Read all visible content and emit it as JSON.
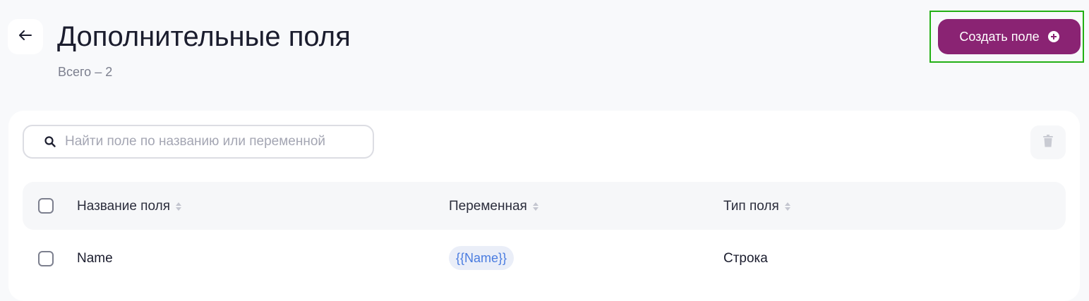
{
  "header": {
    "title": "Дополнительные поля",
    "total": "Всего – 2",
    "create_label": "Создать поле"
  },
  "icons": {
    "back": "arrow-left-icon",
    "create": "plus-circle-icon",
    "search": "search-icon",
    "delete": "trash-icon",
    "sort": "sort-icon"
  },
  "colors": {
    "accent": "#8a2373",
    "highlight": "#22b014",
    "chip_text": "#4a7ce0",
    "chip_bg": "#eaeef8"
  },
  "search": {
    "value": "",
    "placeholder": "Найти поле по названию или переменной"
  },
  "table": {
    "columns": [
      "Название поля",
      "Переменная",
      "Тип поля"
    ],
    "rows": [
      {
        "name": "Name",
        "variable": "{{Name}}",
        "type": "Строка"
      }
    ]
  }
}
